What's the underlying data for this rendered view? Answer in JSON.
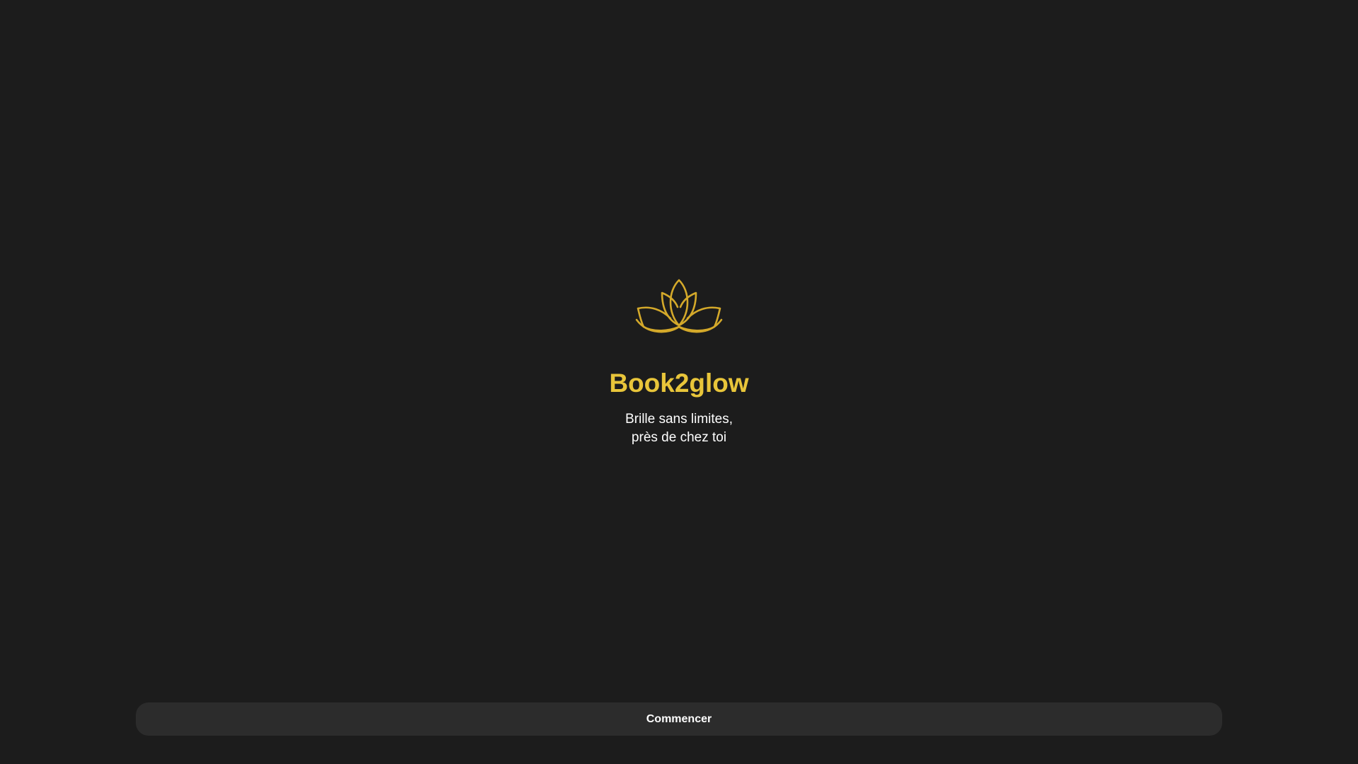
{
  "brand": {
    "logo_icon": "lotus-icon",
    "name": "Book2glow",
    "accent_color": "#e8c53a"
  },
  "tagline": {
    "line1": "Brille sans limites,",
    "line2": "près de chez toi"
  },
  "cta": {
    "label": "Commencer"
  },
  "theme": {
    "background": "#1c1c1c",
    "button_background": "#2c2c2c",
    "text_color": "#ffffff"
  }
}
